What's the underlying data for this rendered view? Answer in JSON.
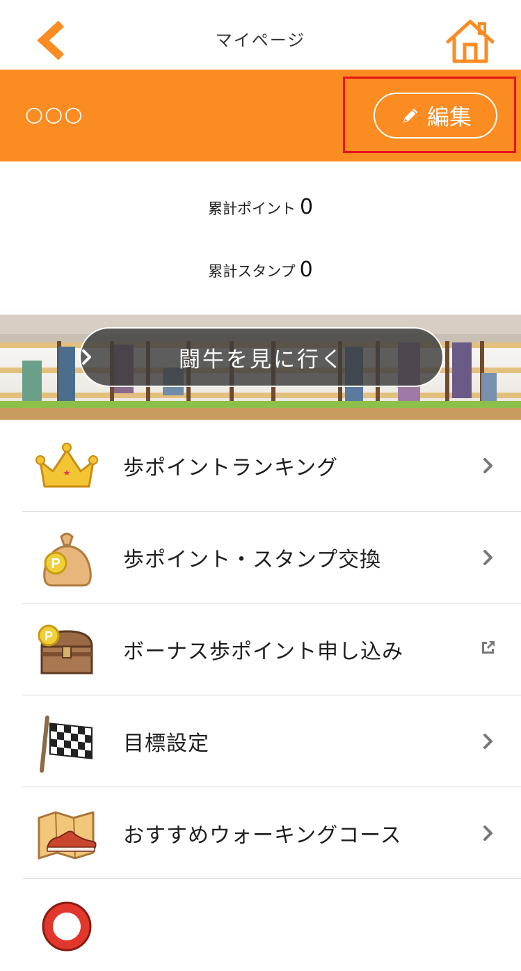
{
  "header": {
    "title": "マイページ",
    "back_icon": "chevron-left-icon",
    "home_icon": "home-icon",
    "accent_color": "#fa8c22"
  },
  "user": {
    "name": "○○○",
    "edit_label": "編集",
    "edit_icon": "pencil-icon"
  },
  "stats": {
    "points_label": "累計ポイント",
    "points_value": "0",
    "stamps_label": "累計スタンプ",
    "stamps_value": "0"
  },
  "banner": {
    "button_label": "闘牛を見に行く"
  },
  "menu": [
    {
      "label": "歩ポイントランキング",
      "icon": "crown-icon",
      "action": "chevron-right-icon"
    },
    {
      "label": "歩ポイント・スタンプ交換",
      "icon": "money-bag-icon",
      "action": "chevron-right-icon"
    },
    {
      "label": "ボーナス歩ポイント申し込み",
      "icon": "treasure-chest-icon",
      "action": "external-link-icon"
    },
    {
      "label": "目標設定",
      "icon": "checkered-flag-icon",
      "action": "chevron-right-icon"
    },
    {
      "label": "おすすめウォーキングコース",
      "icon": "map-shoe-icon",
      "action": "chevron-right-icon"
    }
  ]
}
